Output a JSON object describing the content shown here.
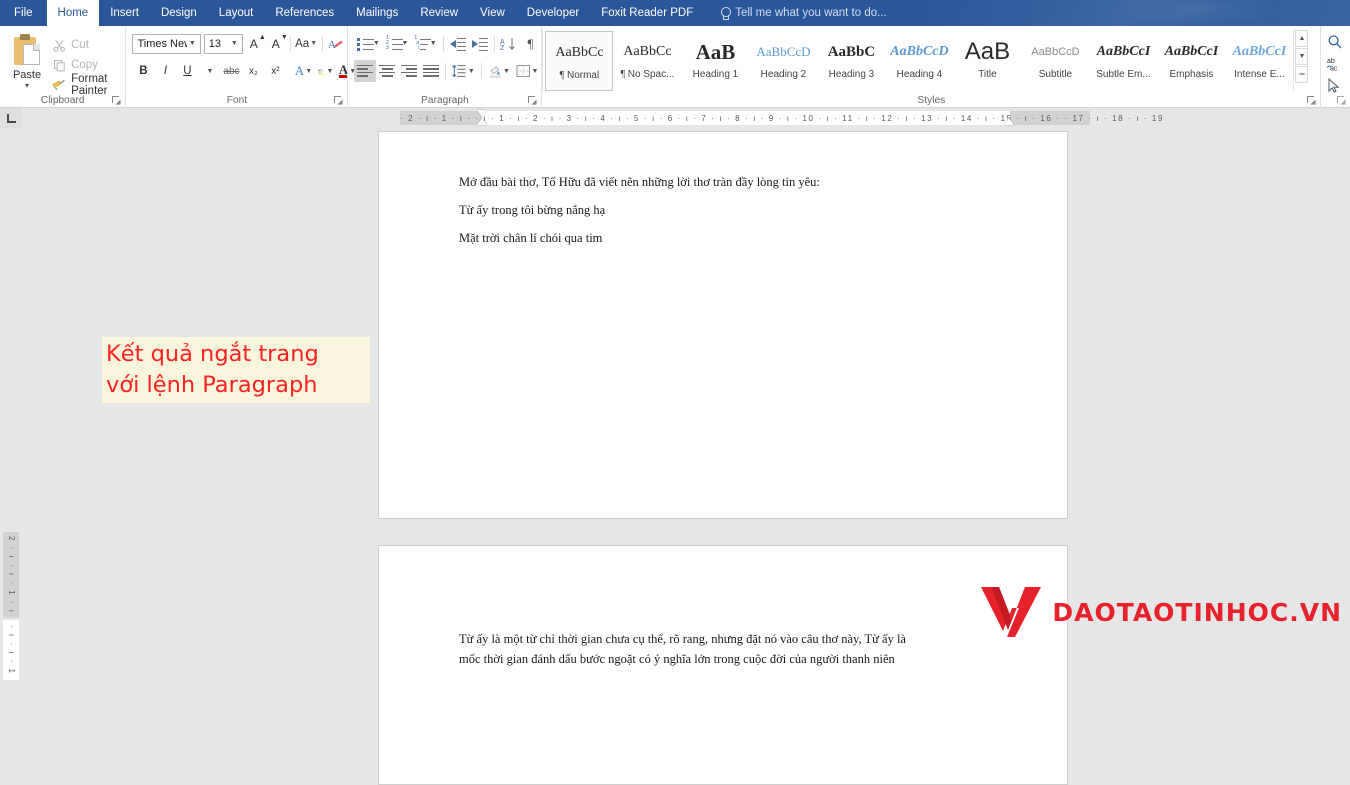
{
  "app": {
    "ribbon_tabs": [
      {
        "label": "File",
        "active": false
      },
      {
        "label": "Home",
        "active": true
      },
      {
        "label": "Insert",
        "active": false
      },
      {
        "label": "Design",
        "active": false
      },
      {
        "label": "Layout",
        "active": false
      },
      {
        "label": "References",
        "active": false
      },
      {
        "label": "Mailings",
        "active": false
      },
      {
        "label": "Review",
        "active": false
      },
      {
        "label": "View",
        "active": false
      },
      {
        "label": "Developer",
        "active": false
      },
      {
        "label": "Foxit Reader PDF",
        "active": false
      }
    ],
    "tell_me": "Tell me what you want to do..."
  },
  "clipboard": {
    "group_label": "Clipboard",
    "paste_label": "Paste",
    "cut_label": "Cut",
    "copy_label": "Copy",
    "format_painter_label": "Format Painter"
  },
  "font": {
    "group_label": "Font",
    "font_name": "Times New Ro",
    "font_size": "13",
    "bold": "B",
    "italic": "I",
    "underline": "U",
    "strikethrough": "abc",
    "subscript": "x₂",
    "superscript": "x²",
    "change_case": "Aa",
    "grow_font": "A",
    "shrink_font": "A",
    "text_effects": "A",
    "highlight": "A",
    "font_color": "A",
    "clear_formatting": "A"
  },
  "paragraph": {
    "group_label": "Paragraph"
  },
  "styles": {
    "group_label": "Styles",
    "items": [
      {
        "preview": "AaBbCc",
        "name": "Normal",
        "pilcrow": true,
        "selected": true,
        "style": "normal",
        "color": "#2a2a2a",
        "size": "14px"
      },
      {
        "preview": "AaBbCc",
        "name": "No Spac...",
        "pilcrow": true,
        "selected": false,
        "style": "normal",
        "color": "#2a2a2a",
        "size": "14px"
      },
      {
        "preview": "AaB",
        "name": "Heading 1",
        "pilcrow": false,
        "selected": false,
        "style": "bold",
        "color": "#1a1a1a",
        "size": "21px"
      },
      {
        "preview": "AaBbCcD",
        "name": "Heading 2",
        "pilcrow": false,
        "selected": false,
        "style": "normal",
        "color": "#5b9bd5",
        "size": "13px"
      },
      {
        "preview": "AaBbC",
        "name": "Heading 3",
        "pilcrow": false,
        "selected": false,
        "style": "bold",
        "color": "#1a1a1a",
        "size": "15px"
      },
      {
        "preview": "AaBbCcD",
        "name": "Heading 4",
        "pilcrow": false,
        "selected": false,
        "style": "bolditalic",
        "color": "#5b9bd5",
        "size": "14px"
      },
      {
        "preview": "AaB",
        "name": "Title",
        "pilcrow": false,
        "selected": false,
        "style": "normal",
        "color": "#1a1a1a",
        "size": "24px"
      },
      {
        "preview": "AaBbCcD",
        "name": "Subtitle",
        "pilcrow": false,
        "selected": false,
        "style": "normal",
        "color": "#888888",
        "size": "11px"
      },
      {
        "preview": "AaBbCcI",
        "name": "Subtle Em...",
        "pilcrow": false,
        "selected": false,
        "style": "bolditalic",
        "color": "#2a2a2a",
        "size": "14px"
      },
      {
        "preview": "AaBbCcI",
        "name": "Emphasis",
        "pilcrow": false,
        "selected": false,
        "style": "bolditalic",
        "color": "#1a1a1a",
        "size": "14px"
      },
      {
        "preview": "AaBbCcI",
        "name": "Intense E...",
        "pilcrow": false,
        "selected": false,
        "style": "bolditalic",
        "color": "#6fa8dc",
        "size": "14px"
      }
    ]
  },
  "editing": {
    "find_label": "Find",
    "replace_label": "Replace",
    "select_label": "Select"
  },
  "ruler": {
    "tab_selector": "L",
    "horizontal_ticks": "· 2 · ı · 1 · ı ·   · ı · 1 · ı · 2 · ı · 3 · ı · 4 · ı · 5 · ı · 6 · ı · 7 · ı · 8 · ı · 9 · ı · 10 · ı · 11 · ı · 12 · ı · 13 · ı · 14 · ı · 15 · ı · 16 ·  · 17 · ı · 18 · ı · 19",
    "vertical_ticks_top": "2 · ı · ı · 1 · ı · ı ·",
    "vertical_ticks_bottom": "· ı · ı · 1"
  },
  "document": {
    "page1_lines": [
      "Mở đầu bài thơ, Tố Hữu đã viết nên những lời thơ tràn đầy lòng tin yêu:",
      "Từ ấy trong tôi bừng nắng hạ",
      "Mặt trời chân lí chói qua tim"
    ],
    "page2_lines": [
      "Từ ấy là một từ chỉ thời gian chưa cụ thể, rõ rang, nhưng đặt nó vào câu thơ này, Từ ấy là",
      "mốc thời gian đánh dấu bước ngoặt có ý nghĩa lớn trong cuộc đời của người thanh niên"
    ]
  },
  "annotation": {
    "line1": "Kết quả ngắt trang",
    "line2": "với lệnh Paragraph",
    "text_color": "#fb2222",
    "background_color": "#faf6dd"
  },
  "watermark": {
    "text": "DAOTAOTINHOC.VN",
    "color": "#e8222a"
  },
  "colors": {
    "ribbon_accent": "#2b579a",
    "workspace_background": "#e6e6e6",
    "page_background": "#ffffff"
  }
}
